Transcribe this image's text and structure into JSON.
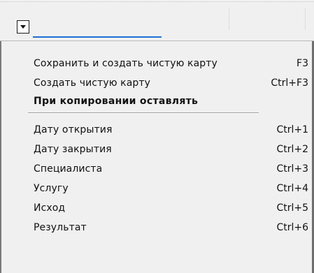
{
  "toolbar": {
    "dropdown_icon": "triangle-down-icon"
  },
  "menu": {
    "items_top": [
      {
        "label": "Сохранить и создать чистую карту",
        "shortcut": "F3"
      },
      {
        "label": "Создать чистую карту",
        "shortcut": "Ctrl+F3"
      }
    ],
    "header": "При копировании оставлять",
    "items_bottom": [
      {
        "label": "Дату открытия",
        "shortcut": "Ctrl+1"
      },
      {
        "label": "Дату закрытия",
        "shortcut": "Ctrl+2"
      },
      {
        "label": "Специалиста",
        "shortcut": "Ctrl+3"
      },
      {
        "label": "Услугу",
        "shortcut": "Ctrl+4"
      },
      {
        "label": "Исход",
        "shortcut": "Ctrl+5"
      },
      {
        "label": "Результат",
        "shortcut": "Ctrl+6"
      }
    ]
  },
  "colors": {
    "toolbar_bg": "#f0f0f0",
    "menu_bg": "#f0f0f0",
    "accent_underline": "#1f6fd6"
  }
}
